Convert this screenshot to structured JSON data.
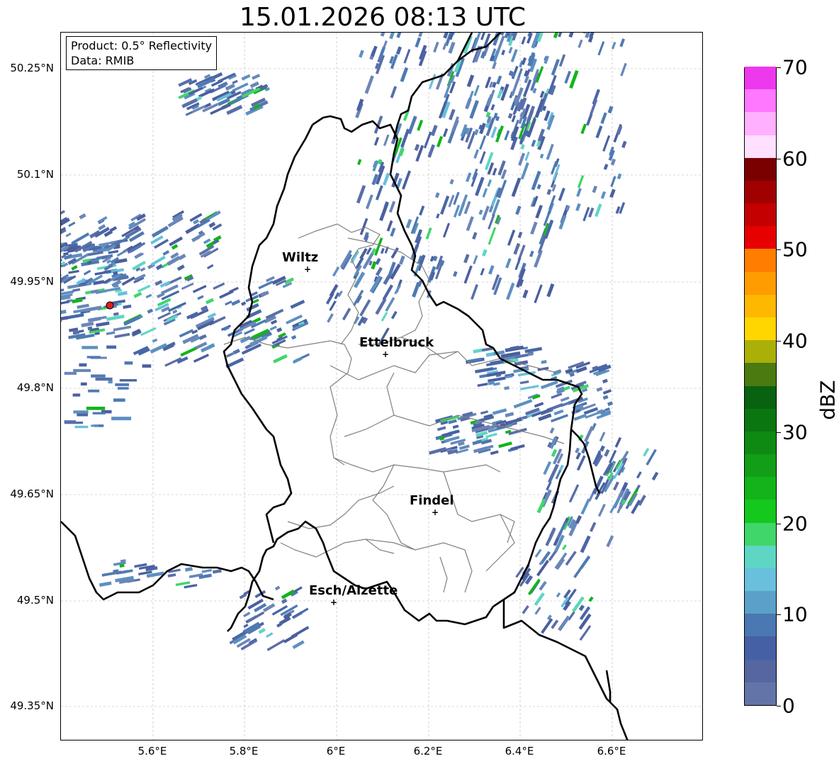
{
  "title": "15.01.2026 08:13 UTC",
  "info": {
    "product": "Product: 0.5° Reflectivity",
    "source": "Data: RMIB"
  },
  "axes": {
    "lat_ticks": [
      "50.25°N",
      "50.1°N",
      "49.95°N",
      "49.8°N",
      "49.65°N",
      "49.5°N",
      "49.35°N"
    ],
    "lon_ticks": [
      "5.6°E",
      "5.8°E",
      "6°E",
      "6.2°E",
      "6.4°E",
      "6.6°E"
    ]
  },
  "cities": [
    {
      "name": "Wiltz",
      "icon": "cross-marker-icon"
    },
    {
      "name": "Ettelbruck",
      "icon": "cross-marker-icon"
    },
    {
      "name": "Findel",
      "icon": "cross-marker-icon"
    },
    {
      "name": "Esch/Alzette",
      "icon": "cross-marker-icon"
    }
  ],
  "radar_site": {
    "icon": "radar-site-dot-icon",
    "color": "#e0201a"
  },
  "colorbar": {
    "label": "dBZ",
    "ticks": [
      "0",
      "10",
      "20",
      "30",
      "40",
      "50",
      "60",
      "70"
    ],
    "range": [
      0,
      70
    ],
    "colors": [
      "#6374a8",
      "#5566a0",
      "#4560a4",
      "#4a78b0",
      "#5ba0c8",
      "#68c0dc",
      "#5fd6c4",
      "#3fd66a",
      "#14c81e",
      "#12b41a",
      "#129e16",
      "#0e8a12",
      "#0a7610",
      "#086210",
      "#4a7a10",
      "#aab008",
      "#ffd600",
      "#ffb800",
      "#ff9c00",
      "#ff7e00",
      "#e60000",
      "#c40000",
      "#a00000",
      "#7a0000",
      "#ffe0ff",
      "#ffb0ff",
      "#ff78ff",
      "#ee38ee"
    ]
  },
  "colors": {
    "border_country": "#000000",
    "border_canton": "#808080",
    "grid": "#b0b0b0"
  }
}
